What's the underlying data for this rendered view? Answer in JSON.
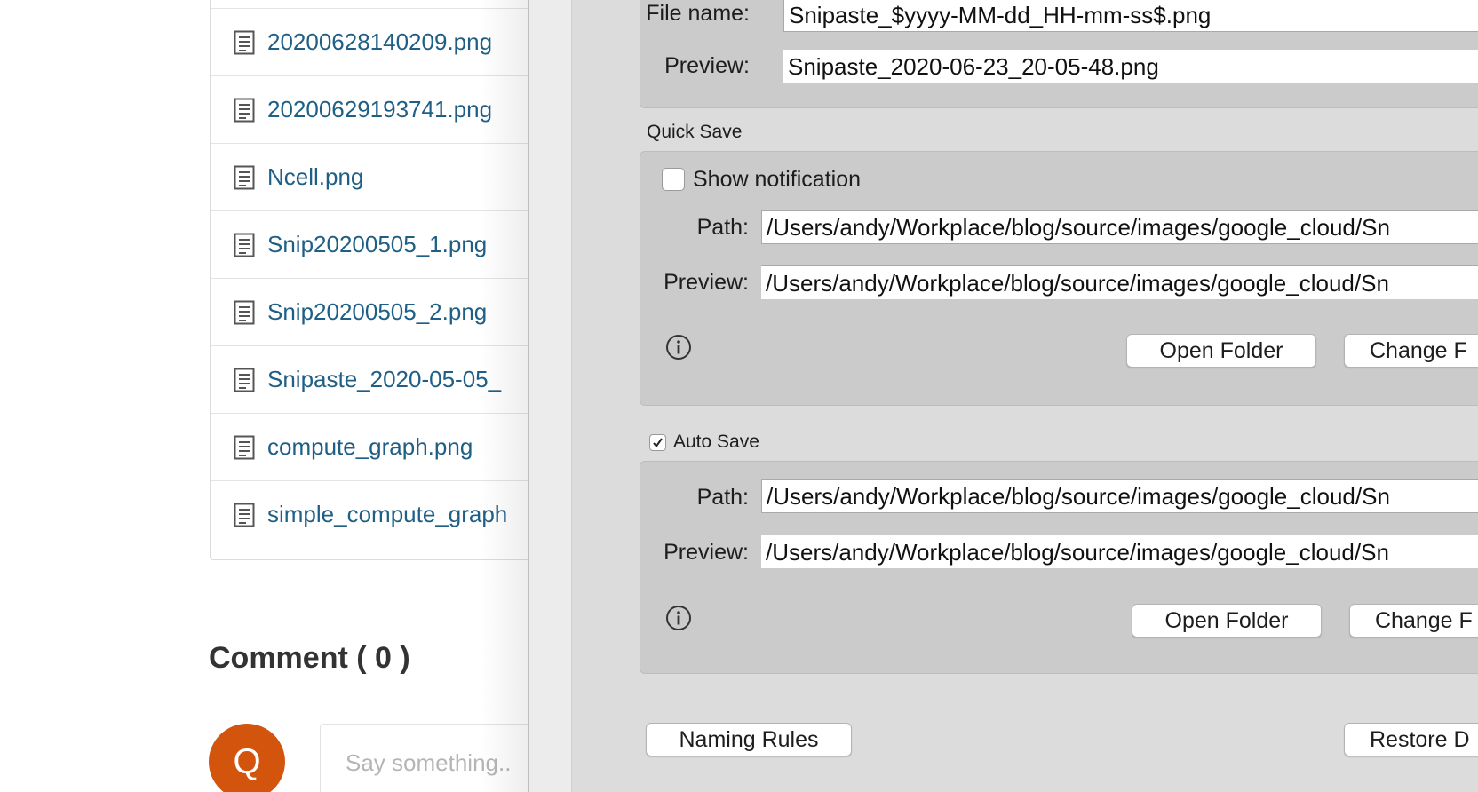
{
  "files": [
    "20200628140209.png",
    "20200629193741.png",
    "Ncell.png",
    "Snip20200505_1.png",
    "Snip20200505_2.png",
    "Snipaste_2020-05-05_",
    "compute_graph.png",
    "simple_compute_graph"
  ],
  "comments": {
    "title": "Comment ( 0 )",
    "avatar_letter": "Q",
    "placeholder": "Say something.."
  },
  "output": {
    "file_name_label": "File name:",
    "file_name_value": "Snipaste_$yyyy-MM-dd_HH-mm-ss$.png",
    "preview_label": "Preview:",
    "preview_value": "Snipaste_2020-06-23_20-05-48.png"
  },
  "quick_save": {
    "title": "Quick Save",
    "show_notification_label": "Show notification",
    "show_notification_checked": false,
    "path_label": "Path:",
    "path_value": "/Users/andy/Workplace/blog/source/images/google_cloud/Sn",
    "preview_label": "Preview:",
    "preview_value": "/Users/andy/Workplace/blog/source/images/google_cloud/Sn",
    "open_folder": "Open Folder",
    "change_folder": "Change F"
  },
  "auto_save": {
    "title": "Auto Save",
    "checked": true,
    "path_label": "Path:",
    "path_value": "/Users/andy/Workplace/blog/source/images/google_cloud/Sn",
    "preview_label": "Preview:",
    "preview_value": "/Users/andy/Workplace/blog/source/images/google_cloud/Sn",
    "open_folder": "Open Folder",
    "change_folder": "Change F"
  },
  "footer": {
    "naming_rules": "Naming Rules",
    "restore_defaults": "Restore D"
  },
  "colors": {
    "link": "#1f5f86",
    "avatar": "#d3540d"
  }
}
